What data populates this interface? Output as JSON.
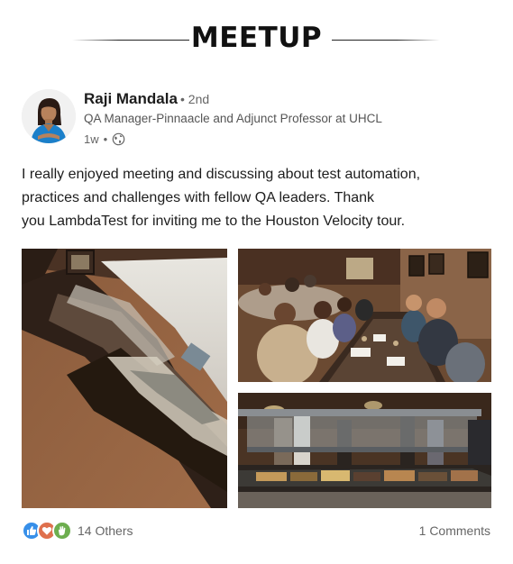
{
  "header": {
    "title": "MEETUP"
  },
  "post": {
    "author": {
      "name": "Raji Mandala",
      "degree": "• 2nd",
      "headline": "QA Manager-Pinnaacle and Adjunct Professor at UHCL",
      "time": "1w",
      "separator": "•",
      "visibility_icon": "globe-icon"
    },
    "text_lines": [
      "I really enjoyed meeting and discussing about test automation,",
      "practices and challenges with fellow QA leaders. Thank",
      "you LambdaTest for inviting me to the Houston Velocity tour."
    ],
    "images": [
      "restaurant-buffet-overview",
      "group-dinner-table",
      "buffet-counter"
    ]
  },
  "social": {
    "reaction_icons": [
      "like-icon",
      "love-icon",
      "celebrate-icon"
    ],
    "reactions_label": "14 Others",
    "comments_label": "1 Comments"
  },
  "colors": {
    "like": "#378fe9",
    "love": "#df704d",
    "celebrate": "#6dae4f",
    "muted_text": "#666666"
  }
}
